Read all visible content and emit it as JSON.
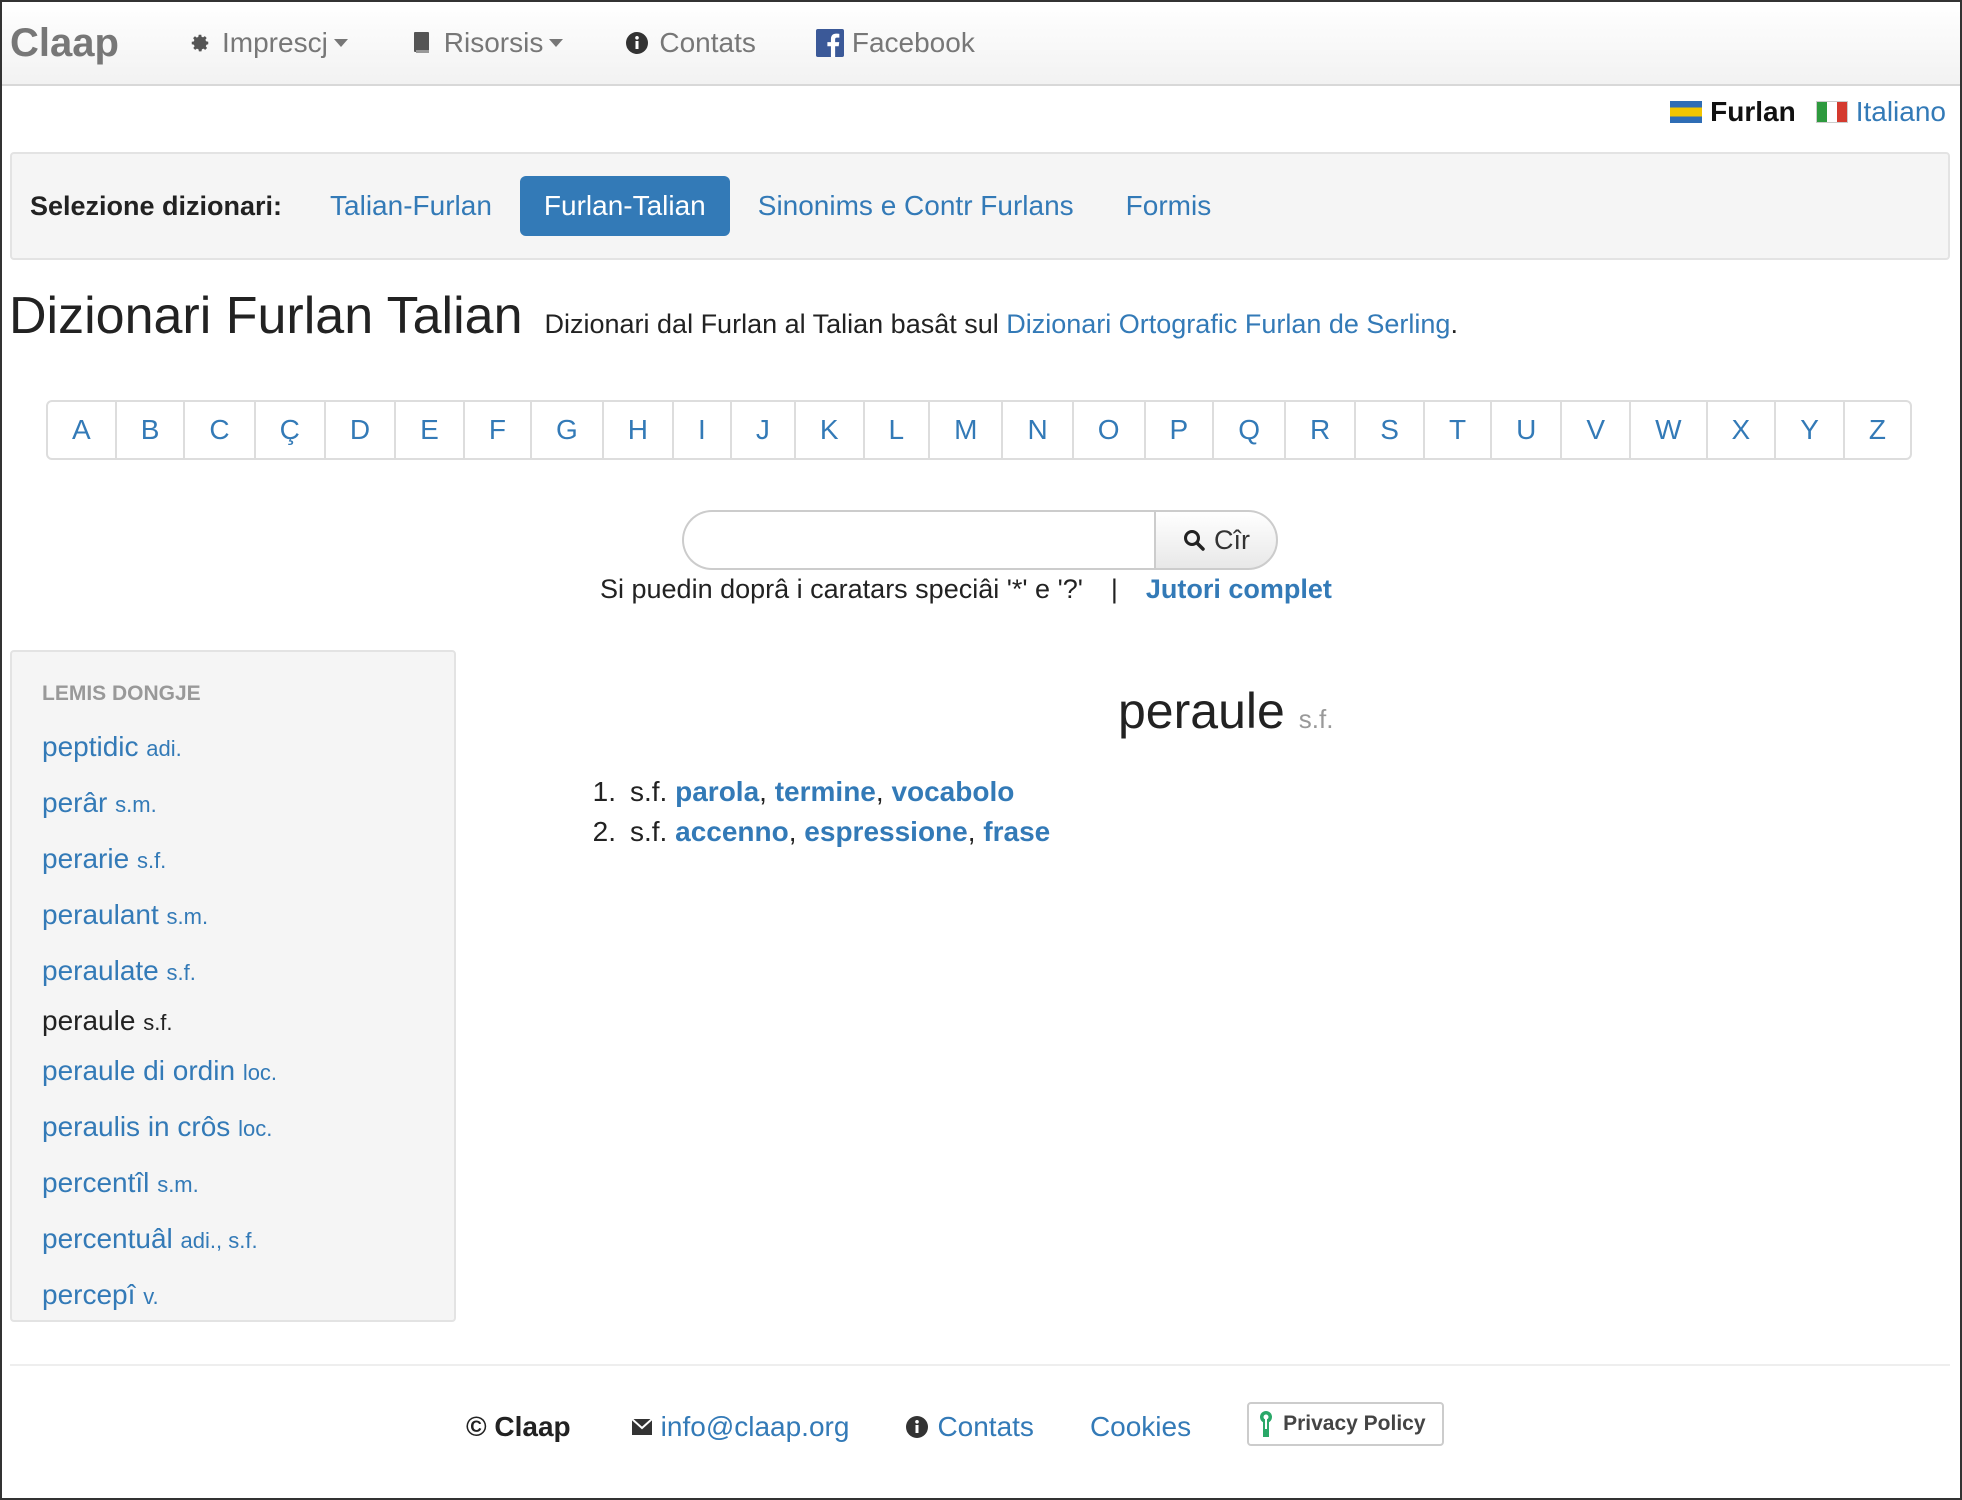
{
  "navbar": {
    "brand": "Claap",
    "items": [
      {
        "label": "Imprescj",
        "icon": "gear-icon",
        "dropdown": true
      },
      {
        "label": "Risorsis",
        "icon": "book-icon",
        "dropdown": true
      },
      {
        "label": "Contats",
        "icon": "info-icon",
        "dropdown": false
      },
      {
        "label": "Facebook",
        "icon": "facebook-icon",
        "dropdown": false
      }
    ]
  },
  "languages": {
    "current": "Furlan",
    "other": "Italiano"
  },
  "selector": {
    "label": "Selezione dizionari:",
    "options": [
      "Talian-Furlan",
      "Furlan-Talian",
      "Sinonims e Contr Furlans",
      "Formis"
    ],
    "active": "Furlan-Talian"
  },
  "heading": {
    "title": "Dizionari Furlan Talian",
    "subtitle_prefix": "Dizionari dal Furlan al Talian basât sul ",
    "subtitle_link": "Dizionari Ortografic Furlan de Serling",
    "subtitle_suffix": "."
  },
  "alphabet": [
    "A",
    "B",
    "C",
    "Ç",
    "D",
    "E",
    "F",
    "G",
    "H",
    "I",
    "J",
    "K",
    "L",
    "M",
    "N",
    "O",
    "P",
    "Q",
    "R",
    "S",
    "T",
    "U",
    "V",
    "W",
    "X",
    "Y",
    "Z"
  ],
  "search": {
    "value": "",
    "button_label": "Cîr",
    "help_text": "Si puedin doprâ i caratars speciâi '*' e '?'",
    "separator": "|",
    "help_link": "Jutori complet"
  },
  "sidebar": {
    "heading": "LEMIS DONGJE",
    "items": [
      {
        "word": "peptidic",
        "pos": "adi.",
        "current": false
      },
      {
        "word": "perâr",
        "pos": "s.m.",
        "current": false
      },
      {
        "word": "perarie",
        "pos": "s.f.",
        "current": false
      },
      {
        "word": "peraulant",
        "pos": "s.m.",
        "current": false
      },
      {
        "word": "peraulate",
        "pos": "s.f.",
        "current": false
      },
      {
        "word": "peraule",
        "pos": "s.f.",
        "current": true
      },
      {
        "word": "peraule di ordin",
        "pos": "loc.",
        "current": false
      },
      {
        "word": "peraulis in crôs",
        "pos": "loc.",
        "current": false
      },
      {
        "word": "percentîl",
        "pos": "s.m.",
        "current": false
      },
      {
        "word": "percentuâl",
        "pos": "adi., s.f.",
        "current": false
      },
      {
        "word": "percepî",
        "pos": "v.",
        "current": false
      }
    ]
  },
  "entry": {
    "word": "peraule",
    "pos": "s.f.",
    "definitions": [
      {
        "num": "1.",
        "pos": "s.f.",
        "translations": [
          "parola",
          "termine",
          "vocabolo"
        ]
      },
      {
        "num": "2.",
        "pos": "s.f.",
        "translations": [
          "accenno",
          "espressione",
          "frase"
        ]
      }
    ]
  },
  "footer": {
    "copyright": "© Claap",
    "email": "info@claap.org",
    "contacts": "Contats",
    "cookies": "Cookies",
    "privacy": "Privacy Policy"
  },
  "colors": {
    "link": "#337ab7",
    "active_pill": "#337ab7",
    "muted": "#777777",
    "panel": "#f5f5f5"
  }
}
